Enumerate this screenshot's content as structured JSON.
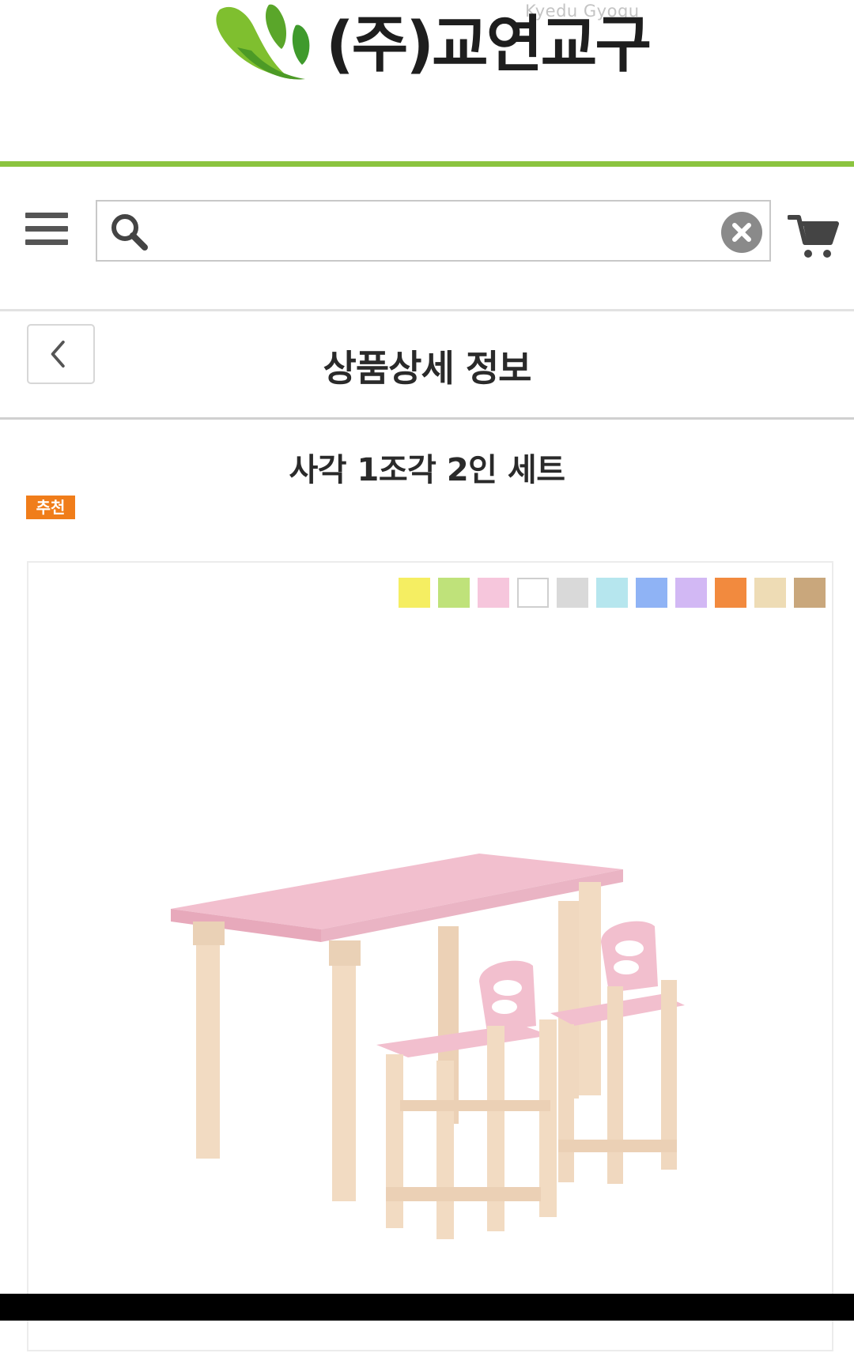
{
  "logo": {
    "text": "(주)교연교구",
    "sub": "Kyedu Gyogu"
  },
  "search": {
    "placeholder": "",
    "value": ""
  },
  "page": {
    "title": "상품상세 정보"
  },
  "product": {
    "name": "사각 1조각 2인 세트",
    "badge": "추천"
  },
  "colors": {
    "accent_line": "#8bc43f",
    "badge": "#f07d1a",
    "swatches": [
      "#f5ee62",
      "#bfe27a",
      "#f6c6dc",
      "#ffffff",
      "#d9d9d9",
      "#b6e6ee",
      "#8fb3f5",
      "#d2b8f4",
      "#f28a3e",
      "#eedcb5",
      "#c9a77c"
    ]
  },
  "icons": [
    "menu-icon",
    "search-icon",
    "clear-icon",
    "cart-icon",
    "back-chevron-icon"
  ]
}
